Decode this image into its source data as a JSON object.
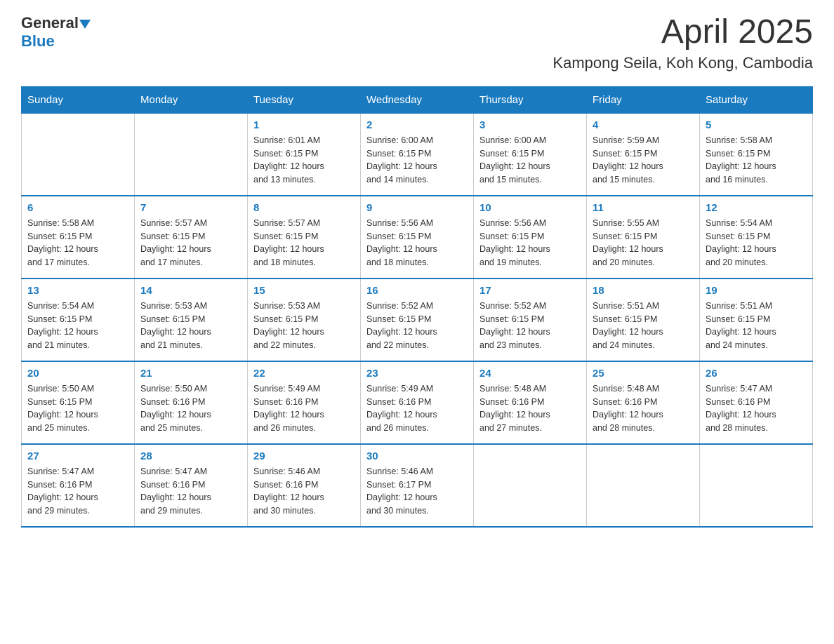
{
  "header": {
    "logo": {
      "general": "General",
      "blue": "Blue"
    },
    "month_title": "April 2025",
    "location": "Kampong Seila, Koh Kong, Cambodia"
  },
  "weekdays": [
    "Sunday",
    "Monday",
    "Tuesday",
    "Wednesday",
    "Thursday",
    "Friday",
    "Saturday"
  ],
  "weeks": [
    [
      {
        "day": "",
        "info": ""
      },
      {
        "day": "",
        "info": ""
      },
      {
        "day": "1",
        "info": "Sunrise: 6:01 AM\nSunset: 6:15 PM\nDaylight: 12 hours\nand 13 minutes."
      },
      {
        "day": "2",
        "info": "Sunrise: 6:00 AM\nSunset: 6:15 PM\nDaylight: 12 hours\nand 14 minutes."
      },
      {
        "day": "3",
        "info": "Sunrise: 6:00 AM\nSunset: 6:15 PM\nDaylight: 12 hours\nand 15 minutes."
      },
      {
        "day": "4",
        "info": "Sunrise: 5:59 AM\nSunset: 6:15 PM\nDaylight: 12 hours\nand 15 minutes."
      },
      {
        "day": "5",
        "info": "Sunrise: 5:58 AM\nSunset: 6:15 PM\nDaylight: 12 hours\nand 16 minutes."
      }
    ],
    [
      {
        "day": "6",
        "info": "Sunrise: 5:58 AM\nSunset: 6:15 PM\nDaylight: 12 hours\nand 17 minutes."
      },
      {
        "day": "7",
        "info": "Sunrise: 5:57 AM\nSunset: 6:15 PM\nDaylight: 12 hours\nand 17 minutes."
      },
      {
        "day": "8",
        "info": "Sunrise: 5:57 AM\nSunset: 6:15 PM\nDaylight: 12 hours\nand 18 minutes."
      },
      {
        "day": "9",
        "info": "Sunrise: 5:56 AM\nSunset: 6:15 PM\nDaylight: 12 hours\nand 18 minutes."
      },
      {
        "day": "10",
        "info": "Sunrise: 5:56 AM\nSunset: 6:15 PM\nDaylight: 12 hours\nand 19 minutes."
      },
      {
        "day": "11",
        "info": "Sunrise: 5:55 AM\nSunset: 6:15 PM\nDaylight: 12 hours\nand 20 minutes."
      },
      {
        "day": "12",
        "info": "Sunrise: 5:54 AM\nSunset: 6:15 PM\nDaylight: 12 hours\nand 20 minutes."
      }
    ],
    [
      {
        "day": "13",
        "info": "Sunrise: 5:54 AM\nSunset: 6:15 PM\nDaylight: 12 hours\nand 21 minutes."
      },
      {
        "day": "14",
        "info": "Sunrise: 5:53 AM\nSunset: 6:15 PM\nDaylight: 12 hours\nand 21 minutes."
      },
      {
        "day": "15",
        "info": "Sunrise: 5:53 AM\nSunset: 6:15 PM\nDaylight: 12 hours\nand 22 minutes."
      },
      {
        "day": "16",
        "info": "Sunrise: 5:52 AM\nSunset: 6:15 PM\nDaylight: 12 hours\nand 22 minutes."
      },
      {
        "day": "17",
        "info": "Sunrise: 5:52 AM\nSunset: 6:15 PM\nDaylight: 12 hours\nand 23 minutes."
      },
      {
        "day": "18",
        "info": "Sunrise: 5:51 AM\nSunset: 6:15 PM\nDaylight: 12 hours\nand 24 minutes."
      },
      {
        "day": "19",
        "info": "Sunrise: 5:51 AM\nSunset: 6:15 PM\nDaylight: 12 hours\nand 24 minutes."
      }
    ],
    [
      {
        "day": "20",
        "info": "Sunrise: 5:50 AM\nSunset: 6:15 PM\nDaylight: 12 hours\nand 25 minutes."
      },
      {
        "day": "21",
        "info": "Sunrise: 5:50 AM\nSunset: 6:16 PM\nDaylight: 12 hours\nand 25 minutes."
      },
      {
        "day": "22",
        "info": "Sunrise: 5:49 AM\nSunset: 6:16 PM\nDaylight: 12 hours\nand 26 minutes."
      },
      {
        "day": "23",
        "info": "Sunrise: 5:49 AM\nSunset: 6:16 PM\nDaylight: 12 hours\nand 26 minutes."
      },
      {
        "day": "24",
        "info": "Sunrise: 5:48 AM\nSunset: 6:16 PM\nDaylight: 12 hours\nand 27 minutes."
      },
      {
        "day": "25",
        "info": "Sunrise: 5:48 AM\nSunset: 6:16 PM\nDaylight: 12 hours\nand 28 minutes."
      },
      {
        "day": "26",
        "info": "Sunrise: 5:47 AM\nSunset: 6:16 PM\nDaylight: 12 hours\nand 28 minutes."
      }
    ],
    [
      {
        "day": "27",
        "info": "Sunrise: 5:47 AM\nSunset: 6:16 PM\nDaylight: 12 hours\nand 29 minutes."
      },
      {
        "day": "28",
        "info": "Sunrise: 5:47 AM\nSunset: 6:16 PM\nDaylight: 12 hours\nand 29 minutes."
      },
      {
        "day": "29",
        "info": "Sunrise: 5:46 AM\nSunset: 6:16 PM\nDaylight: 12 hours\nand 30 minutes."
      },
      {
        "day": "30",
        "info": "Sunrise: 5:46 AM\nSunset: 6:17 PM\nDaylight: 12 hours\nand 30 minutes."
      },
      {
        "day": "",
        "info": ""
      },
      {
        "day": "",
        "info": ""
      },
      {
        "day": "",
        "info": ""
      }
    ]
  ]
}
